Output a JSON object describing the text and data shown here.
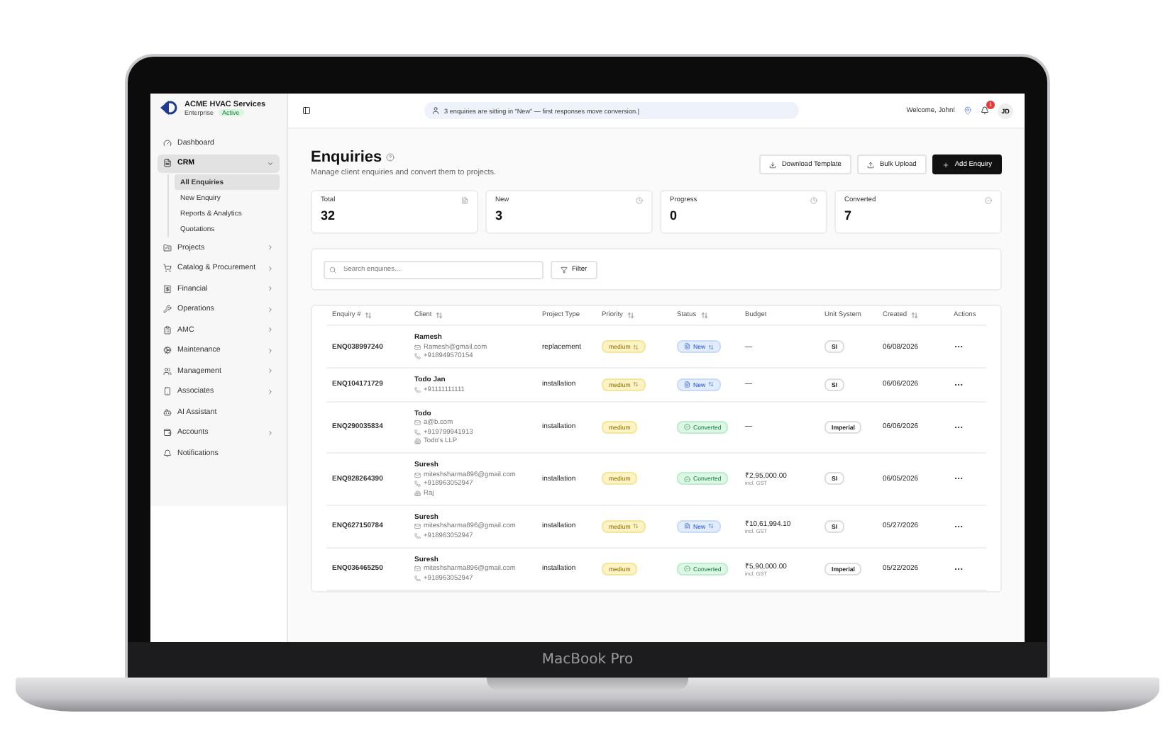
{
  "device": {
    "label": "MacBook Pro"
  },
  "brand": {
    "name": "ACME HVAC Services",
    "plan": "Enterprise",
    "status": "Active"
  },
  "sidebar": {
    "items": [
      {
        "label": "Dashboard",
        "kind": "link",
        "selected": false
      },
      {
        "label": "CRM",
        "kind": "group",
        "expanded": true,
        "selected": true,
        "children": [
          {
            "label": "All Enquiries",
            "selected": true
          },
          {
            "label": "New Enquiry",
            "selected": false
          },
          {
            "label": "Reports & Analytics",
            "selected": false
          },
          {
            "label": "Quotations",
            "selected": false
          }
        ]
      },
      {
        "label": "Projects",
        "kind": "group",
        "expanded": false,
        "selected": false
      },
      {
        "label": "Catalog & Procurement",
        "kind": "group",
        "expanded": false,
        "selected": false
      },
      {
        "label": "Financial",
        "kind": "group",
        "expanded": false,
        "selected": false
      },
      {
        "label": "Operations",
        "kind": "group",
        "expanded": false,
        "selected": false
      },
      {
        "label": "AMC",
        "kind": "group",
        "expanded": false,
        "selected": false
      },
      {
        "label": "Maintenance",
        "kind": "group",
        "expanded": false,
        "selected": false
      },
      {
        "label": "Management",
        "kind": "group",
        "expanded": false,
        "selected": false
      },
      {
        "label": "Associates",
        "kind": "group",
        "expanded": false,
        "selected": false
      },
      {
        "label": "AI Assistant",
        "kind": "link",
        "selected": false
      },
      {
        "label": "Accounts",
        "kind": "group",
        "expanded": false,
        "selected": false
      },
      {
        "label": "Notifications",
        "kind": "link",
        "selected": false
      }
    ]
  },
  "topbar": {
    "banner": "3 enquiries are sitting in “New” — first responses move conversion.|",
    "welcome": "Welcome, John!",
    "notification_count": "1",
    "avatar": "JD"
  },
  "page": {
    "title": "Enquiries",
    "subtitle": "Manage client enquiries and convert them to projects.",
    "buttons": [
      {
        "label": "Download Template",
        "kind": "download"
      },
      {
        "label": "Bulk Upload",
        "kind": "upload"
      },
      {
        "label": "Add Enquiry",
        "kind": "primary"
      }
    ]
  },
  "stats": [
    {
      "label": "Total",
      "value": "32",
      "kind": "file"
    },
    {
      "label": "New",
      "value": "3",
      "kind": "clock"
    },
    {
      "label": "Progress",
      "value": "0",
      "kind": "clock"
    },
    {
      "label": "Converted",
      "value": "7",
      "kind": "check"
    }
  ],
  "search": {
    "placeholder": "Search enquiries...",
    "filter": "Filter"
  },
  "table": {
    "columns": [
      {
        "label": "Enquiry #",
        "sortable": true
      },
      {
        "label": "Client",
        "sortable": true
      },
      {
        "label": "Project Type",
        "sortable": false
      },
      {
        "label": "Priority",
        "sortable": true
      },
      {
        "label": "Status",
        "sortable": true
      },
      {
        "label": "Budget",
        "sortable": false
      },
      {
        "label": "Unit System",
        "sortable": false
      },
      {
        "label": "Created",
        "sortable": true
      },
      {
        "label": "Actions",
        "sortable": false
      }
    ],
    "rows": [
      {
        "id": "ENQ038997240",
        "client": "Ramesh",
        "contacts": [
          {
            "kind": "email",
            "text": "Ramesh@gmail.com"
          },
          {
            "kind": "phone",
            "text": "+918949570154"
          }
        ],
        "project_type": "replacement",
        "priority": {
          "label": "medium",
          "dropdown": true
        },
        "status": {
          "label": "New",
          "kind": "new",
          "dropdown": true
        },
        "budget": "—",
        "unit": "SI",
        "created": "06/08/2026"
      },
      {
        "id": "ENQ104171729",
        "client": "Todo Jan",
        "contacts": [
          {
            "kind": "phone",
            "text": "+91111111111"
          }
        ],
        "project_type": "installation",
        "priority": {
          "label": "medium",
          "dropdown": true
        },
        "status": {
          "label": "New",
          "kind": "new",
          "dropdown": true
        },
        "budget": "—",
        "unit": "SI",
        "created": "06/06/2026"
      },
      {
        "id": "ENQ290035834",
        "client": "Todo",
        "contacts": [
          {
            "kind": "email",
            "text": "a@b.com"
          },
          {
            "kind": "phone",
            "text": "+919799941913"
          },
          {
            "kind": "company",
            "text": "Todo's LLP"
          }
        ],
        "project_type": "installation",
        "priority": {
          "label": "medium",
          "dropdown": false
        },
        "status": {
          "label": "Converted",
          "kind": "converted",
          "dropdown": false
        },
        "budget": "—",
        "unit": "Imperial",
        "created": "06/06/2026"
      },
      {
        "id": "ENQ928264390",
        "client": "Suresh",
        "contacts": [
          {
            "kind": "email",
            "text": "miteshsharma896@gmail.com"
          },
          {
            "kind": "phone",
            "text": "+918963052947"
          },
          {
            "kind": "company",
            "text": "Raj"
          }
        ],
        "project_type": "installation",
        "priority": {
          "label": "medium",
          "dropdown": false
        },
        "status": {
          "label": "Converted",
          "kind": "converted",
          "dropdown": false
        },
        "budget": "₹2,95,000.00",
        "budget_note": "incl. GST",
        "unit": "SI",
        "created": "06/05/2026"
      },
      {
        "id": "ENQ627150784",
        "client": "Suresh",
        "contacts": [
          {
            "kind": "email",
            "text": "miteshsharma896@gmail.com"
          },
          {
            "kind": "phone",
            "text": "+918963052947"
          }
        ],
        "project_type": "installation",
        "priority": {
          "label": "medium",
          "dropdown": true
        },
        "status": {
          "label": "New",
          "kind": "new",
          "dropdown": true
        },
        "budget": "₹10,61,994.10",
        "budget_note": "incl. GST",
        "unit": "SI",
        "created": "05/27/2026"
      },
      {
        "id": "ENQ036465250",
        "client": "Suresh",
        "contacts": [
          {
            "kind": "email",
            "text": "miteshsharma896@gmail.com"
          },
          {
            "kind": "phone",
            "text": "+918963052947"
          }
        ],
        "project_type": "installation",
        "priority": {
          "label": "medium",
          "dropdown": false
        },
        "status": {
          "label": "Converted",
          "kind": "converted",
          "dropdown": false
        },
        "budget": "₹5,90,000.00",
        "budget_note": "incl. GST",
        "unit": "Imperial",
        "created": "05/22/2026"
      }
    ]
  }
}
